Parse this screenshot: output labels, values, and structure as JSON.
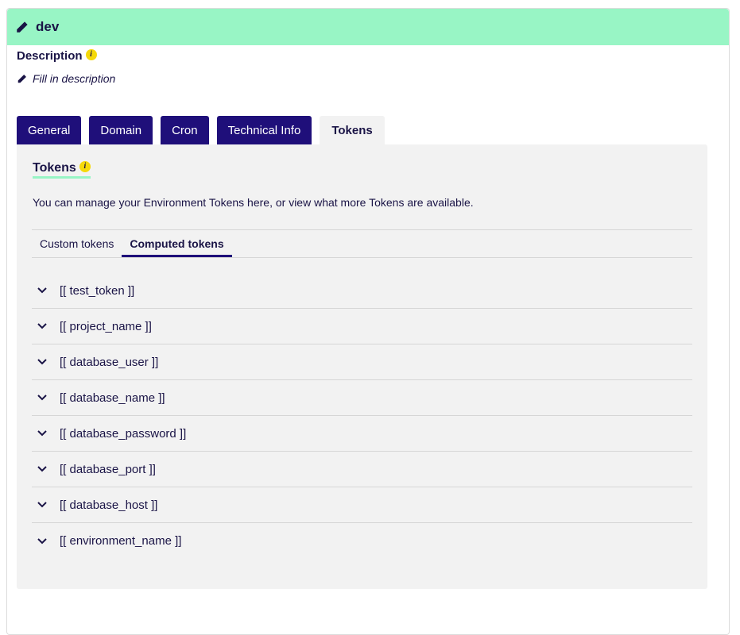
{
  "header": {
    "title": "dev",
    "icon": "pencil-icon",
    "bg_color": "#98f5c5"
  },
  "description": {
    "label": "Description",
    "info_icon": "i",
    "placeholder": "Fill in description"
  },
  "tabs": [
    {
      "label": "General",
      "active": false
    },
    {
      "label": "Domain",
      "active": false
    },
    {
      "label": "Cron",
      "active": false
    },
    {
      "label": "Technical Info",
      "active": false
    },
    {
      "label": "Tokens",
      "active": true
    }
  ],
  "panel": {
    "title": "Tokens",
    "info_icon": "i",
    "text": "You can manage your Environment Tokens here, or view what more Tokens are available.",
    "subtabs": [
      {
        "label": "Custom tokens",
        "active": false
      },
      {
        "label": "Computed tokens",
        "active": true
      }
    ],
    "tokens": [
      "[[ test_token ]]",
      "[[ project_name ]]",
      "[[ database_user ]]",
      "[[ database_name ]]",
      "[[ database_password ]]",
      "[[ database_port ]]",
      "[[ database_host ]]",
      "[[ environment_name ]]"
    ]
  },
  "colors": {
    "primary": "#1f0f7a",
    "accent": "#98f5c5",
    "info": "#f5d90a",
    "panel_bg": "#f2f2f2"
  }
}
